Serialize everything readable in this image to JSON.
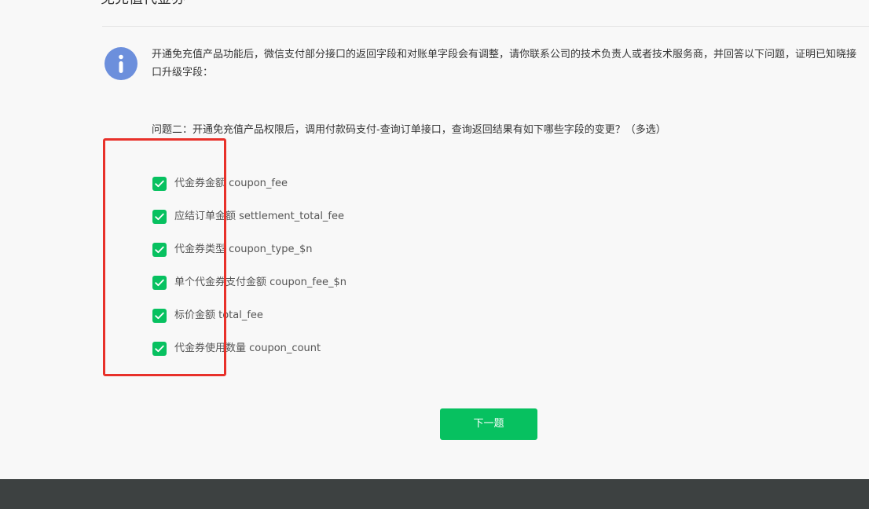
{
  "header": {
    "title": "免充值代金券"
  },
  "notice": {
    "icon": "info-icon",
    "icon_color": "#6c8fdc",
    "text": "开通免充值产品功能后，微信支付部分接口的返回字段和对账单字段会有调整，请你联系公司的技术负责人或者技术服务商，并回答以下问题，证明已知晓接口升级字段："
  },
  "question": {
    "text": "问题二：开通免充值产品权限后，调用付款码支付-查询订单接口，查询返回结果有如下哪些字段的变更？（多选）",
    "options": [
      {
        "label": "代金券金额 coupon_fee",
        "checked": true
      },
      {
        "label": "应结订单金额 settlement_total_fee",
        "checked": true
      },
      {
        "label": "代金券类型 coupon_type_$n",
        "checked": true
      },
      {
        "label": "单个代金券支付金额 coupon_fee_$n",
        "checked": true
      },
      {
        "label": "标价金额 total_fee",
        "checked": true
      },
      {
        "label": "代金券使用数量 coupon_count",
        "checked": true
      }
    ]
  },
  "actions": {
    "next_label": "下一题"
  },
  "colors": {
    "accent": "#07c160",
    "highlight_border": "#e8312a",
    "footer": "#3d4141",
    "background": "#f8f8f8"
  }
}
